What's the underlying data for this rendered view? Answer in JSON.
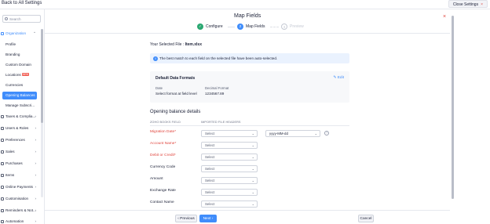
{
  "topbar": {
    "back_label": "Back to All Settings",
    "close_label": "Close Settings",
    "close_icon": "×"
  },
  "sidebar": {
    "search_placeholder": "Search",
    "items": [
      {
        "label": "Organization",
        "icon": "building-icon",
        "chevron": "⌃",
        "state": "open"
      },
      {
        "label": "Profile"
      },
      {
        "label": "Branding"
      },
      {
        "label": "Custom Domain"
      },
      {
        "label": "Locations",
        "badge": "NEW"
      },
      {
        "label": "Currencies"
      },
      {
        "label": "Opening Balances",
        "state": "active"
      },
      {
        "label": "Manage Subscri..."
      },
      {
        "label": "Taxes & Complia...",
        "icon": "tax-icon",
        "chevron": "›"
      },
      {
        "label": "Users & Roles",
        "icon": "users-icon",
        "chevron": "›"
      },
      {
        "label": "Preferences",
        "icon": "sliders-icon",
        "chevron": "›"
      },
      {
        "label": "Sales",
        "icon": "sales-icon",
        "chevron": "›"
      },
      {
        "label": "Purchases",
        "icon": "cart-icon",
        "chevron": "›"
      },
      {
        "label": "Items",
        "icon": "box-icon",
        "chevron": "›"
      },
      {
        "label": "Online Payments",
        "icon": "card-icon",
        "chevron": "›"
      },
      {
        "label": "Customisation",
        "icon": "paint-icon",
        "chevron": "›"
      },
      {
        "label": "Reminders & Not...",
        "icon": "bell-icon",
        "chevron": "›"
      },
      {
        "label": "Automation",
        "icon": "automation-icon",
        "chevron": "›"
      }
    ]
  },
  "header": {
    "title": "Map Fields",
    "steps": [
      {
        "number": "✓",
        "label": "Configure",
        "state": "done"
      },
      {
        "number": "2",
        "label": "Map Fields",
        "state": "current"
      },
      {
        "number": "3",
        "label": "Preview",
        "state": "pending"
      }
    ],
    "close_icon": "×"
  },
  "main": {
    "selected_file_prefix": "Your Selected File : ",
    "selected_file_name": "Item.xlsx",
    "info_text": "The best match to each field on the selected file have been auto-selected.",
    "info_icon": "i",
    "formats": {
      "title": "Default Data Formats",
      "edit_label": "Edit",
      "date_label": "Date",
      "date_value": "Select format at field level",
      "decimal_label": "Decimal Format",
      "decimal_value": "1234567.89"
    },
    "section_title": "Opening balance details",
    "column_headers": [
      "ZOHO BOOKS FIELD",
      "IMPORTED FILE HEADERS"
    ],
    "rows": [
      {
        "label": "Migration Date*",
        "required": true,
        "value": "Select"
      },
      {
        "label": "Account Name*",
        "required": true,
        "value": "Select"
      },
      {
        "label": "Debit or Credit*",
        "required": true,
        "value": "Select"
      },
      {
        "label": "Currency Code",
        "required": false,
        "value": "Select"
      },
      {
        "label": "Amount",
        "required": false,
        "value": "Select"
      },
      {
        "label": "Exchange Rate",
        "required": false,
        "value": "Select"
      },
      {
        "label": "Contact Name",
        "required": false,
        "value": "Select"
      }
    ],
    "date_format_value": "yyyy-MM-dd",
    "help_icon": "?",
    "caret": "⌄"
  },
  "footer": {
    "previous_label": "‹ Previous",
    "next_label": "Next ›",
    "cancel_label": "Cancel"
  }
}
